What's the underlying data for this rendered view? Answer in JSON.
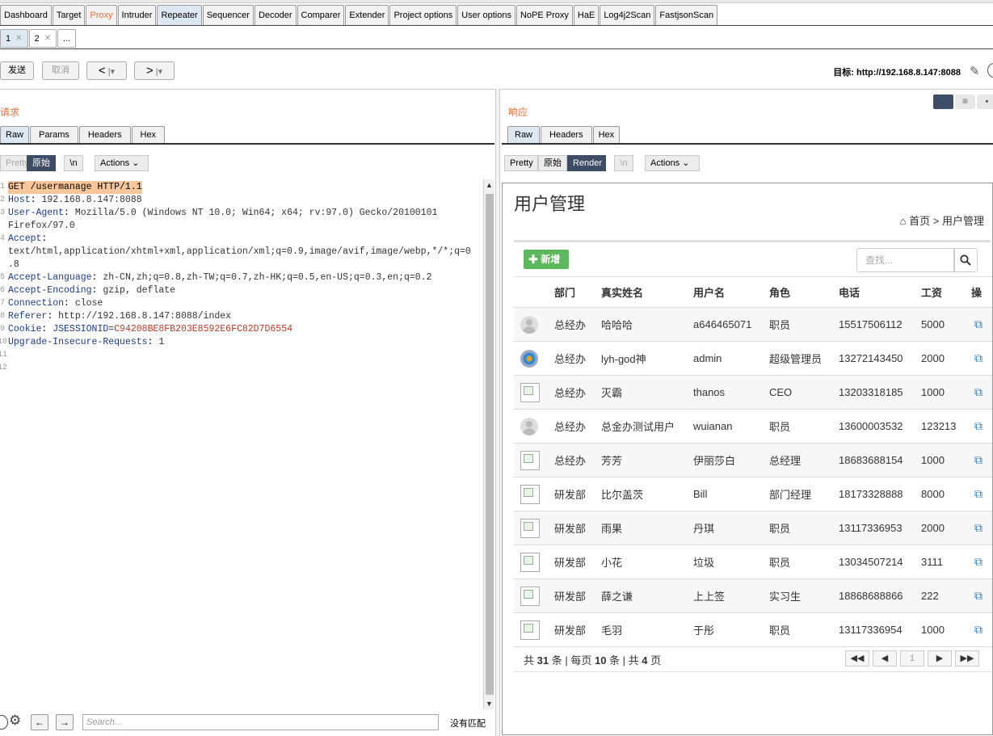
{
  "main_tabs": [
    {
      "label": "Dashboard"
    },
    {
      "label": "Target"
    },
    {
      "label": "Proxy"
    },
    {
      "label": "Intruder"
    },
    {
      "label": "Repeater"
    },
    {
      "label": "Sequencer"
    },
    {
      "label": "Decoder"
    },
    {
      "label": "Comparer"
    },
    {
      "label": "Extender"
    },
    {
      "label": "Project options"
    },
    {
      "label": "User options"
    },
    {
      "label": "NoPE Proxy"
    },
    {
      "label": "HaE"
    },
    {
      "label": "Log4j2Scan"
    },
    {
      "label": "FastjsonScan"
    }
  ],
  "sub_tabs": [
    {
      "label": "1"
    },
    {
      "label": "2"
    },
    {
      "label": "..."
    }
  ],
  "toolbar": {
    "send": "发送",
    "cancel": "取消",
    "back": "<",
    "forward": ">",
    "target_label": "目标: http://192.168.8.147:8088"
  },
  "request": {
    "title": "请求",
    "tabs": [
      "Raw",
      "Params",
      "Headers",
      "Hex"
    ],
    "view_buttons": {
      "pretty": "Pretty",
      "raw": "原始",
      "newline": "\\n",
      "actions": "Actions"
    },
    "line_numbers": [
      "1",
      "2",
      "3",
      "",
      "4",
      "",
      "5",
      "6",
      "7",
      "8",
      "9",
      "10",
      "11",
      "12"
    ],
    "lines": [
      {
        "text": "GET /usermanage HTTP/1.1"
      },
      {
        "key": "Host",
        "value": " 192.168.8.147:8088"
      },
      {
        "key": "User-Agent",
        "value": " Mozilla/5.0 (Windows NT 10.0; Win64; x64; rv:97.0) Gecko/20100101"
      },
      {
        "text": "Firefox/97.0"
      },
      {
        "key": "Accept",
        "value": ""
      },
      {
        "text": "text/html,application/xhtml+xml,application/xml;q=0.9,image/avif,image/webp,*/*;q=0"
      },
      {
        "text": ".8"
      },
      {
        "key": "Accept-Language",
        "value": " zh-CN,zh;q=0.8,zh-TW;q=0.7,zh-HK;q=0.5,en-US;q=0.3,en;q=0.2"
      },
      {
        "key": "Accept-Encoding",
        "value": " gzip, deflate"
      },
      {
        "key": "Connection",
        "value": " close"
      },
      {
        "key": "Referer",
        "value": " http://192.168.8.147:8088/index"
      },
      {
        "key": "Cookie",
        "value": " JSESSIONID=",
        "cookie": "C94208BE8FB203E8592E6FC82D7D6554"
      },
      {
        "key": "Upgrade-Insecure-Requests",
        "value": " 1"
      }
    ]
  },
  "bottom": {
    "search_placeholder": "Search...",
    "matches": "没有匹配"
  },
  "response": {
    "title": "响应",
    "tabs": [
      "Raw",
      "Headers",
      "Hex"
    ],
    "view_buttons": {
      "pretty": "Pretty",
      "raw": "原始",
      "render": "Render",
      "newline": "\\n",
      "actions": "Actions"
    }
  },
  "page": {
    "title": "用户管理",
    "breadcrumb_home": "首页",
    "breadcrumb_sep": ">",
    "breadcrumb_current": "用户管理",
    "add_button": "新增",
    "search_placeholder": "查找...",
    "columns": [
      "部门",
      "真实姓名",
      "用户名",
      "角色",
      "电话",
      "工资",
      "操"
    ],
    "rows": [
      {
        "avatar": "person",
        "dept": "总经办",
        "name": "哈哈哈",
        "user": "a646465071",
        "role": "职员",
        "phone": "15517506112",
        "salary": "5000"
      },
      {
        "avatar": "logo",
        "dept": "总经办",
        "name": "lyh-god神",
        "user": "admin",
        "role": "超级管理员",
        "phone": "13272143450",
        "salary": "2000"
      },
      {
        "avatar": "broken",
        "dept": "总经办",
        "name": "灭霸",
        "user": "thanos",
        "role": "CEO",
        "phone": "13203318185",
        "salary": "1000"
      },
      {
        "avatar": "person",
        "dept": "总经办",
        "name": "总金办测试用户",
        "user": "wuianan",
        "role": "职员",
        "phone": "13600003532",
        "salary": "123213"
      },
      {
        "avatar": "broken",
        "dept": "总经办",
        "name": "芳芳",
        "user": "伊丽莎白",
        "role": "总经理",
        "phone": "18683688154",
        "salary": "1000"
      },
      {
        "avatar": "broken",
        "dept": "研发部",
        "name": "比尔盖茨",
        "user": "Bill",
        "role": "部门经理",
        "phone": "18173328888",
        "salary": "8000"
      },
      {
        "avatar": "broken",
        "dept": "研发部",
        "name": "雨果",
        "user": "丹琪",
        "role": "职员",
        "phone": "13117336953",
        "salary": "2000"
      },
      {
        "avatar": "broken",
        "dept": "研发部",
        "name": "小花",
        "user": "垃圾",
        "role": "职员",
        "phone": "13034507214",
        "salary": "3111"
      },
      {
        "avatar": "broken",
        "dept": "研发部",
        "name": "薛之谦",
        "user": "上上签",
        "role": "实习生",
        "phone": "18868688866",
        "salary": "222"
      },
      {
        "avatar": "broken",
        "dept": "研发部",
        "name": "毛羽",
        "user": "于彤",
        "role": "职员",
        "phone": "13117336954",
        "salary": "1000"
      }
    ],
    "pager": {
      "prefix": "共",
      "total": "31",
      "unit1": "条 | 每页",
      "per_page": "10",
      "unit2": "条 | 共",
      "pages": "4",
      "unit3": "页",
      "current": "1"
    }
  },
  "colors": {
    "accent": "#e8703a",
    "active_tab": "#dde8f3",
    "render_on": "#3d4d66",
    "add_green": "#5cb85c"
  }
}
